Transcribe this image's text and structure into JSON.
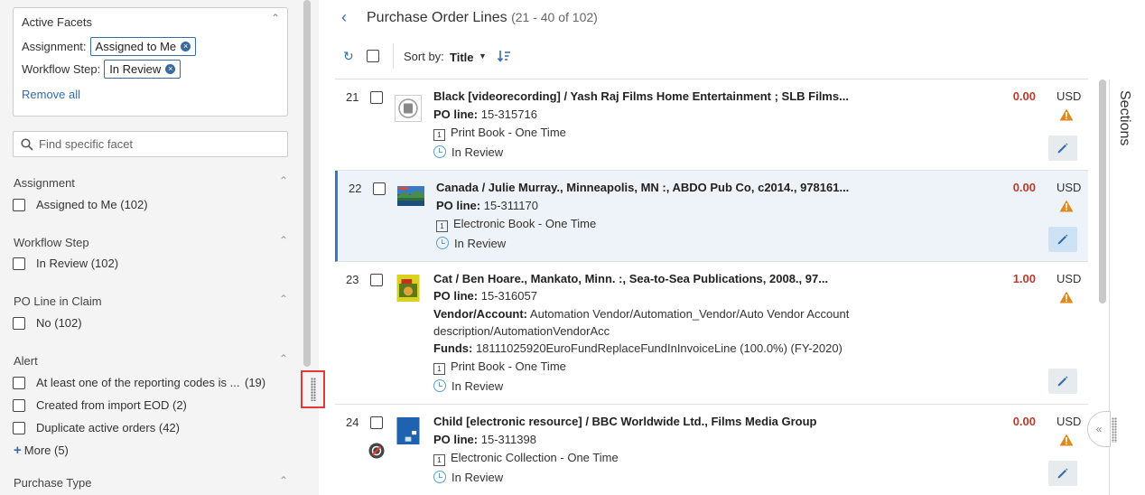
{
  "facets": {
    "title": "Active Facets",
    "assignment_label": "Assignment:",
    "assignment_value": "Assigned to Me",
    "workflow_label": "Workflow Step:",
    "workflow_value": "In Review",
    "remove_all": "Remove all"
  },
  "search": {
    "placeholder": "Find specific facet"
  },
  "groups": {
    "assignment": {
      "title": "Assignment",
      "options": [
        {
          "label": "Assigned to Me",
          "count": "(102)"
        }
      ]
    },
    "workflow": {
      "title": "Workflow Step",
      "options": [
        {
          "label": "In Review",
          "count": "(102)"
        }
      ]
    },
    "claim": {
      "title": "PO Line in Claim",
      "options": [
        {
          "label": "No",
          "count": "(102)"
        }
      ]
    },
    "alert": {
      "title": "Alert",
      "options": [
        {
          "label": "At least one of the reporting codes is ...",
          "count": "(19)"
        },
        {
          "label": "Created from import EOD",
          "count": "(2)"
        },
        {
          "label": "Duplicate active orders",
          "count": "(42)"
        }
      ],
      "more": "More (5)"
    },
    "purchase_type": {
      "title": "Purchase Type"
    }
  },
  "header": {
    "title": "Purchase Order Lines",
    "range": "(21 - 40 of 102)"
  },
  "toolbar": {
    "sort_by": "Sort by:",
    "sort_value": "Title"
  },
  "rows": [
    {
      "num": "21",
      "title": "Black [videorecording] / Yash Raj Films Home Entertainment ; SLB Films...",
      "po_label": "PO line:",
      "po_value": "15-315716",
      "type": "Print Book - One Time",
      "status": "In Review",
      "price": "0.00",
      "currency": "USD"
    },
    {
      "num": "22",
      "title": "Canada / Julie Murray., Minneapolis, MN :, ABDO Pub Co, c2014., 978161...",
      "po_label": "PO line:",
      "po_value": "15-311170",
      "type": "Electronic Book - One Time",
      "status": "In Review",
      "price": "0.00",
      "currency": "USD"
    },
    {
      "num": "23",
      "title": "Cat / Ben Hoare., Mankato, Minn. :, Sea-to-Sea Publications, 2008., 97...",
      "po_label": "PO line:",
      "po_value": "15-316057",
      "vendor_label": "Vendor/Account:",
      "vendor_value": "Automation Vendor/Automation_Vendor/Auto Vendor Account",
      "vendor_value2": "description/AutomationVendorAcc",
      "funds_label": "Funds:",
      "funds_value": "18111025920EuroFundReplaceFundInInvoiceLine (100.0%) (FY-2020)",
      "type": "Print Book - One Time",
      "status": "In Review",
      "price": "1.00",
      "currency": "USD"
    },
    {
      "num": "24",
      "title": "Child [electronic resource] / BBC Worldwide Ltd., Films Media Group",
      "po_label": "PO line:",
      "po_value": "15-311398",
      "type": "Electronic Collection - One Time",
      "status": "In Review",
      "price": "0.00",
      "currency": "USD"
    }
  ],
  "sections": {
    "label": "Sections"
  },
  "colors": {
    "accent": "#2f6cb0",
    "price": "#c0392b",
    "warning": "#e08a1e",
    "selected_bg": "#edf3f8"
  }
}
